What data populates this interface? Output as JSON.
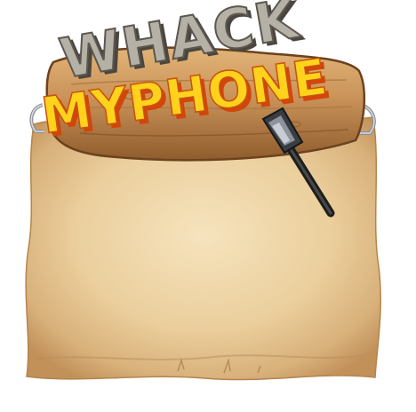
{
  "logo": {
    "line1": "WHACK",
    "line2": "MYPHONE"
  },
  "colors": {
    "parchment_light": "#f2dcb0",
    "parchment_mid": "#e6c690",
    "parchment_edge": "#c99a5c",
    "wood_light": "#d9a867",
    "wood_dark": "#8a5a2b",
    "title_grey": "#a9a49a",
    "title_yellow": "#ffd21c",
    "title_orange": "#e8560e"
  }
}
